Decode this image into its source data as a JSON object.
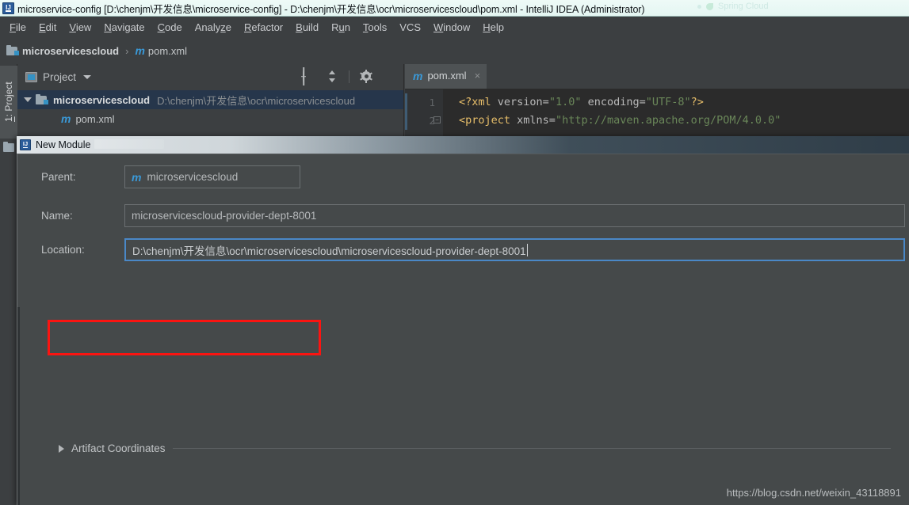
{
  "window": {
    "title": "microservice-config [D:\\chenjm\\开发信息\\microservice-config] - D:\\chenjm\\开发信息\\ocr\\microservicescloud\\pom.xml - IntelliJ IDEA (Administrator)",
    "icon": "intellij-idea-icon",
    "ghost_text": "Spring Cloud"
  },
  "menubar": {
    "items": [
      {
        "label": "File",
        "mnemonic": "F"
      },
      {
        "label": "Edit",
        "mnemonic": "E"
      },
      {
        "label": "View",
        "mnemonic": "V"
      },
      {
        "label": "Navigate",
        "mnemonic": "N"
      },
      {
        "label": "Code",
        "mnemonic": "C"
      },
      {
        "label": "Analyze",
        "mnemonic": "z"
      },
      {
        "label": "Refactor",
        "mnemonic": "R"
      },
      {
        "label": "Build",
        "mnemonic": "B"
      },
      {
        "label": "Run",
        "mnemonic": "u"
      },
      {
        "label": "Tools",
        "mnemonic": "T"
      },
      {
        "label": "VCS",
        "mnemonic": ""
      },
      {
        "label": "Window",
        "mnemonic": "W"
      },
      {
        "label": "Help",
        "mnemonic": "H"
      }
    ]
  },
  "breadcrumb": {
    "items": [
      {
        "label": "microservicescloud",
        "icon": "module-icon"
      },
      {
        "label": "pom.xml",
        "icon": "maven-m-icon"
      }
    ],
    "separator": "›"
  },
  "sidebar": {
    "tab_prefix": "1",
    "tab_label": ": Project",
    "folder_icon": "folder-icon"
  },
  "project_panel": {
    "title": "Project",
    "title_icon": "project-icon",
    "dropdown_icon": "chevron-down-icon",
    "tools": [
      {
        "name": "locate-icon",
        "title": "Select Opened File"
      },
      {
        "name": "collapse-all-icon",
        "title": "Collapse All"
      },
      {
        "name": "gear-icon",
        "title": "Settings"
      },
      {
        "name": "minimize-icon",
        "title": "Hide"
      }
    ],
    "tree": [
      {
        "name": "microservicescloud",
        "path": "D:\\chenjm\\开发信息\\ocr\\microservicescloud",
        "selected": true,
        "expanded": true,
        "icon": "module-icon"
      },
      {
        "name": "pom.xml",
        "selected": false,
        "icon": "maven-m-icon"
      }
    ]
  },
  "editor": {
    "tab": {
      "label": "pom.xml",
      "icon": "maven-m-icon",
      "close": "×"
    },
    "lines": [
      {
        "number": "1"
      },
      {
        "number": "2"
      }
    ],
    "code": {
      "line1_open": "<?xml ",
      "line1_attr1": "version=",
      "line1_val1": "\"1.0\"",
      "line1_attr2": " encoding=",
      "line1_val2": "\"UTF-8\"",
      "line1_close": "?>",
      "line2_open": "<project ",
      "line2_attr1": "xmlns=",
      "line2_val1": "\"http://maven.apache.org/POM/4.0.0\""
    },
    "fold_marker": "−"
  },
  "dialog": {
    "title": "New Module",
    "icon": "intellij-idea-icon",
    "fields": [
      {
        "label": "Parent:",
        "value": "microservicescloud",
        "icon": "maven-m-icon",
        "focused": false,
        "highlighted": true
      },
      {
        "label": "Name:",
        "value": "microservicescloud-provider-dept-8001",
        "focused": false,
        "highlighted": false
      },
      {
        "label": "Location:",
        "value": "D:\\chenjm\\开发信息\\ocr\\microservicescloud\\microservicescloud-provider-dept-8001",
        "focused": true,
        "highlighted": false
      }
    ],
    "artifact_section": {
      "label": "Artifact Coordinates",
      "expander_icon": "chevron-right-icon",
      "expanded": false
    },
    "highlight_color": "#fb1411",
    "focus_color": "#4a88c7"
  },
  "watermark": {
    "text": "https://blog.csdn.net/weixin_43118891"
  }
}
